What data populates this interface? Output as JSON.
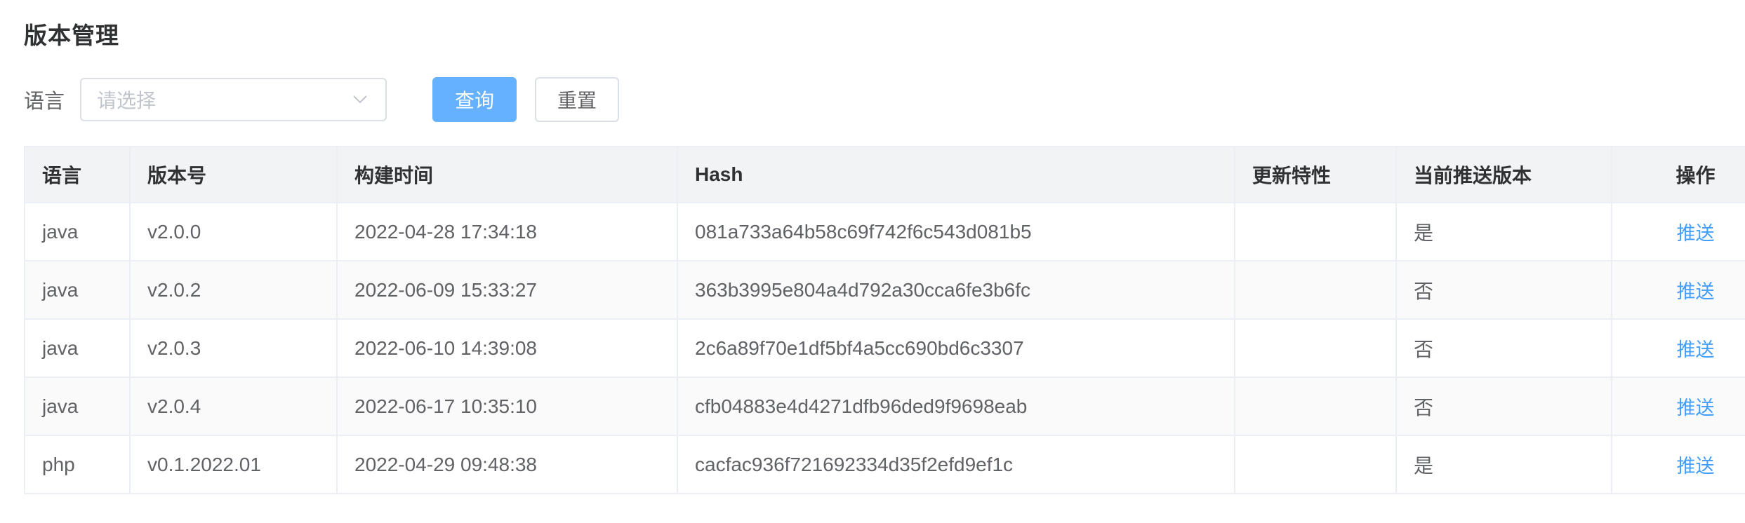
{
  "page": {
    "title": "版本管理"
  },
  "filter": {
    "language_label": "语言",
    "language_placeholder": "请选择",
    "query_label": "查询",
    "reset_label": "重置"
  },
  "table": {
    "headers": {
      "language": "语言",
      "version": "版本号",
      "build_time": "构建时间",
      "hash": "Hash",
      "features": "更新特性",
      "current_push": "当前推送版本",
      "action": "操作"
    },
    "rows": [
      {
        "language": "java",
        "version": "v2.0.0",
        "build_time": "2022-04-28 17:34:18",
        "hash": "081a733a64b58c69f742f6c543d081b5",
        "features": "",
        "current_push": "是",
        "action": "推送"
      },
      {
        "language": "java",
        "version": "v2.0.2",
        "build_time": "2022-06-09 15:33:27",
        "hash": "363b3995e804a4d792a30cca6fe3b6fc",
        "features": "",
        "current_push": "否",
        "action": "推送"
      },
      {
        "language": "java",
        "version": "v2.0.3",
        "build_time": "2022-06-10 14:39:08",
        "hash": "2c6a89f70e1df5bf4a5cc690bd6c3307",
        "features": "",
        "current_push": "否",
        "action": "推送"
      },
      {
        "language": "java",
        "version": "v2.0.4",
        "build_time": "2022-06-17 10:35:10",
        "hash": "cfb04883e4d4271dfb96ded9f9698eab",
        "features": "",
        "current_push": "否",
        "action": "推送"
      },
      {
        "language": "php",
        "version": "v0.1.2022.01",
        "build_time": "2022-04-29 09:48:38",
        "hash": "cacfac936f721692334d35f2efd9ef1c",
        "features": "",
        "current_push": "是",
        "action": "推送"
      }
    ]
  },
  "colors": {
    "primary": "#409eff",
    "primary_light": "#66b1ff",
    "header_bg": "#f2f3f5",
    "border": "#ebeef5"
  },
  "icons": {
    "select_arrow": "chevron-down-icon"
  }
}
